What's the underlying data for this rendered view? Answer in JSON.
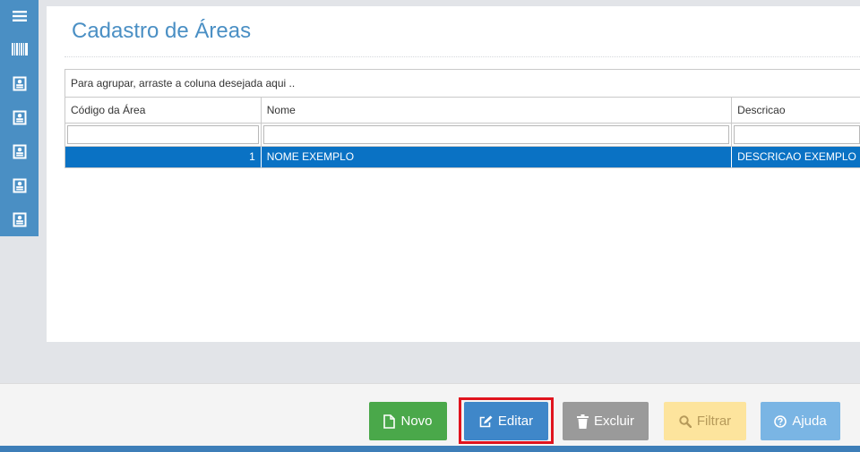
{
  "sidebar": {
    "items": [
      {
        "icon": "menu-icon"
      },
      {
        "icon": "barcode-icon"
      },
      {
        "icon": "contact-card-icon"
      },
      {
        "icon": "contact-card-icon"
      },
      {
        "icon": "contact-card-icon"
      },
      {
        "icon": "contact-card-icon"
      },
      {
        "icon": "contact-card-icon"
      }
    ]
  },
  "page": {
    "title": "Cadastro de Áreas"
  },
  "grid": {
    "group_hint": "Para agrupar, arraste a coluna desejada aqui ..",
    "columns": [
      "Código da Área",
      "Nome",
      "Descricao"
    ],
    "filters": [
      "",
      "",
      ""
    ],
    "rows": [
      {
        "codigo": "1",
        "nome": "NOME EXEMPLO",
        "descricao": "DESCRICAO EXEMPLO"
      }
    ]
  },
  "toolbar": {
    "novo": "Novo",
    "editar": "Editar",
    "excluir": "Excluir",
    "filtrar": "Filtrar",
    "ajuda": "Ajuda"
  },
  "colors": {
    "sidebar": "#4a8fc4",
    "selected_row": "#0a72c4",
    "novo": "#4aa84a",
    "editar": "#3f87c9",
    "excluir": "#9a9a9a",
    "filtrar": "#fde49d",
    "ajuda": "#7ab5e4",
    "highlight": "#e0141e"
  }
}
